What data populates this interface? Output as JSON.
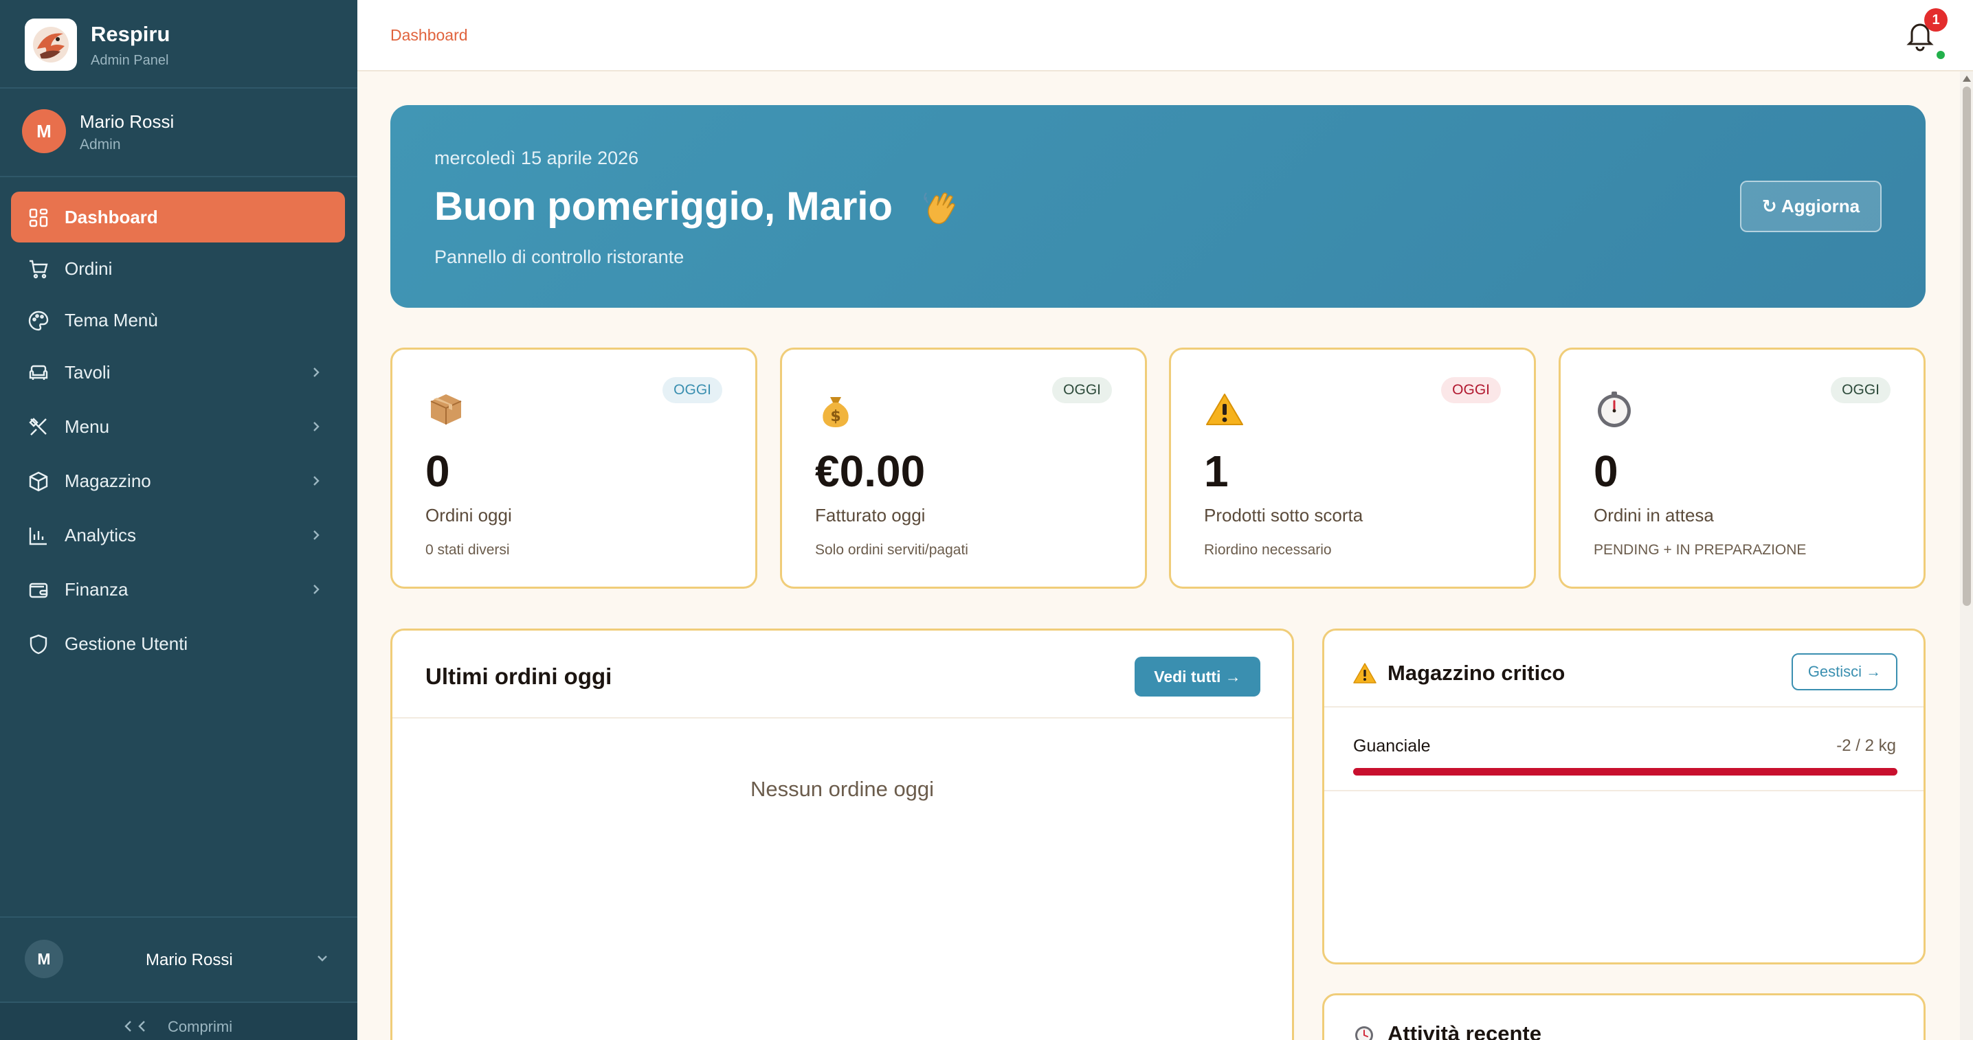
{
  "brand": {
    "name": "Respiru",
    "subtitle": "Admin Panel"
  },
  "user": {
    "initial": "M",
    "name": "Mario Rossi",
    "role": "Admin"
  },
  "nav": {
    "items": [
      {
        "label": "Dashboard",
        "icon": "grid-icon",
        "active": true
      },
      {
        "label": "Ordini",
        "icon": "cart-icon"
      },
      {
        "label": "Tema Menù",
        "icon": "palette-icon"
      },
      {
        "label": "Tavoli",
        "icon": "armchair-icon",
        "expandable": true
      },
      {
        "label": "Menu",
        "icon": "utensils-icon",
        "expandable": true
      },
      {
        "label": "Magazzino",
        "icon": "box-icon",
        "expandable": true
      },
      {
        "label": "Analytics",
        "icon": "bar-chart-icon",
        "expandable": true
      },
      {
        "label": "Finanza",
        "icon": "wallet-icon",
        "expandable": true
      },
      {
        "label": "Gestione Utenti",
        "icon": "shield-icon"
      }
    ]
  },
  "sidebar_footer": {
    "user_initial": "M",
    "user_name": "Mario Rossi",
    "collapse_label": "Comprimi"
  },
  "topbar": {
    "breadcrumb": "Dashboard",
    "notification_count": "1"
  },
  "hero": {
    "date": "mercoledì 15 aprile 2026",
    "greeting": "Buon pomeriggio, Mario",
    "subtitle": "Pannello di controllo ristorante",
    "refresh_label": "↻ Aggiorna"
  },
  "stats": [
    {
      "badge": "OGGI",
      "icon": "package-icon",
      "value": "0",
      "label": "Ordini oggi",
      "sub": "0 stati diversi",
      "badge_color": "#3a8fb0",
      "badge_bg": "#e6f1f6"
    },
    {
      "badge": "OGGI",
      "icon": "money-bag-icon",
      "value": "€0.00",
      "label": "Fatturato oggi",
      "sub": "Solo ordini serviti/pagati",
      "badge_color": "#2c4a3a",
      "badge_bg": "#eaf1ec"
    },
    {
      "badge": "OGGI",
      "icon": "warning-icon",
      "value": "1",
      "label": "Prodotti sotto scorta",
      "sub": "Riordino necessario",
      "badge_color": "#b1182f",
      "badge_bg": "#fbe7e8"
    },
    {
      "badge": "OGGI",
      "icon": "timer-icon",
      "value": "0",
      "label": "Ordini in attesa",
      "sub": "PENDING + IN PREPARAZIONE",
      "badge_color": "#2c4a3a",
      "badge_bg": "#eaf1ec"
    }
  ],
  "orders": {
    "title": "Ultimi ordini oggi",
    "view_all_label": "Vedi tutti →",
    "empty_text": "Nessun ordine oggi"
  },
  "stock": {
    "title": "Magazzino critico",
    "manage_label": "Gestisci →",
    "items": [
      {
        "name": "Guanciale",
        "qty": "-2 / 2 kg",
        "fill_fraction": 1.0
      }
    ]
  },
  "activity": {
    "title": "Attività recente"
  },
  "colors": {
    "sidebar": "#234857",
    "accent": "#e8734e",
    "primary": "#3a8fb0",
    "card_border": "#f0cd79",
    "danger": "#c8102e"
  }
}
